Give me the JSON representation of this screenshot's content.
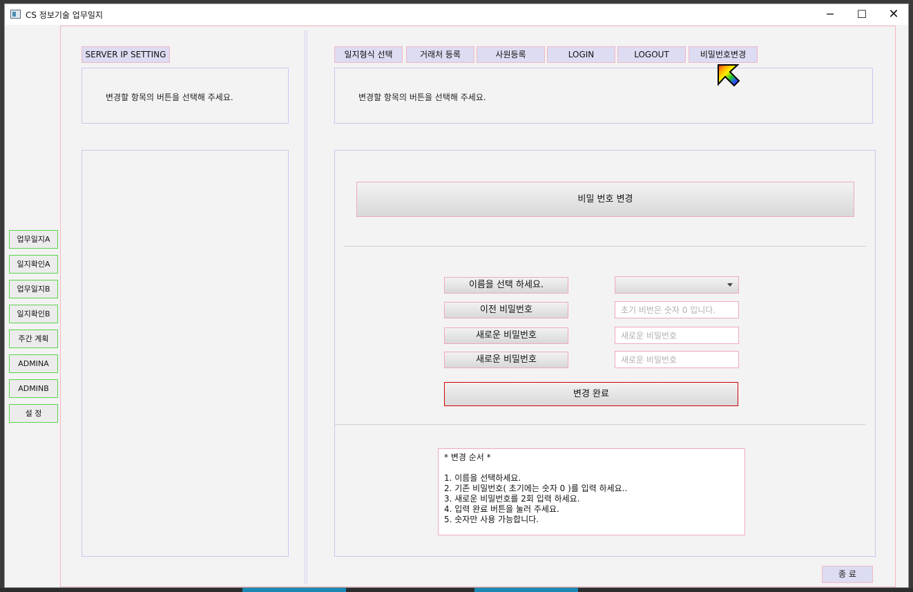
{
  "window": {
    "title": "CS 정보기술 업무일지",
    "controls": {
      "minimize": "─",
      "maximize": "☐",
      "close": "✕"
    }
  },
  "sidebar": {
    "items": [
      {
        "label": "업무일지A"
      },
      {
        "label": "일지확인A"
      },
      {
        "label": "업무일지B"
      },
      {
        "label": "일지확인B"
      },
      {
        "label": "주간 계획"
      },
      {
        "label": "ADMINA"
      },
      {
        "label": "ADMINB"
      },
      {
        "label": "설   정"
      }
    ]
  },
  "left_panel": {
    "server_button": "SERVER IP SETTING",
    "hint": "변경할 항목의 버튼을 선택해 주세요."
  },
  "top_tabs": [
    {
      "label": "일지형식 선택"
    },
    {
      "label": "거래처 등록"
    },
    {
      "label": "사원등록"
    },
    {
      "label": "LOGIN"
    },
    {
      "label": "LOGOUT"
    },
    {
      "label": "비밀번호변경"
    }
  ],
  "right_panel": {
    "hint": "변경할 항목의 버튼을 선택해 주세요.",
    "section_title": "비밀 번호 변경",
    "labels": {
      "name": "이름을 선택 하세요.",
      "old_password": "이전 비밀번호",
      "new_password": "새로운 비밀번호",
      "confirm_password": "새로운 비밀번호"
    },
    "name_select_value": "",
    "placeholders": {
      "old_password": "초기 비번은 숫자 0 입니다.",
      "new_password": "새로운 비밀번호",
      "confirm_password": "새로운 비밀번호"
    },
    "submit_label": "변경 완료",
    "notes": [
      "* 변경 순서 *",
      "",
      "1. 이름을 선택하세요.",
      "2. 기존 비밀번호( 초기에는 숫자 0 )를 입력 하세요..",
      "3. 새로운 비밀번호를 2회 입력 하세요.",
      "4. 입력 완료 버튼을 눌러 주세요.",
      "5. 숫자만 사용 가능합니다."
    ]
  },
  "footer": {
    "exit_label": "종    료"
  },
  "colors": {
    "window_bg": "#f3f3f3",
    "sidebar_border": "#58d34a",
    "tab_bg": "#dcdcf3",
    "field_border": "#f0a9b8",
    "submit_border": "#d40000",
    "panel_border": "#c9c6ee"
  },
  "cursor": {
    "icon": "rainbow-arrow-cursor-icon"
  }
}
